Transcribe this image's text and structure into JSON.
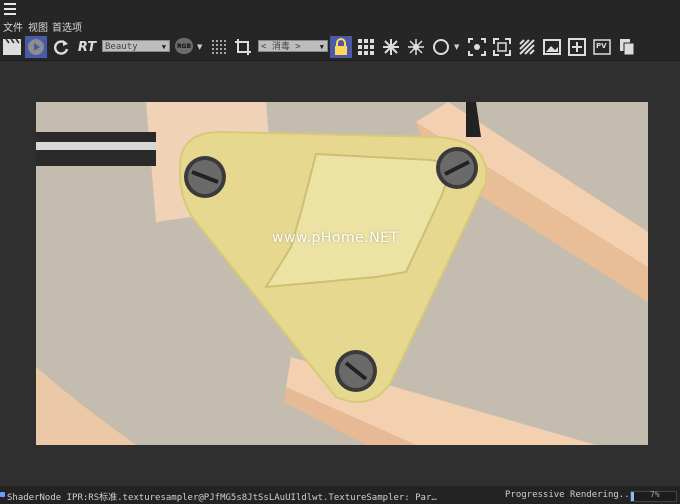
{
  "menu": {
    "items": [
      "文件",
      "视图",
      "首选项"
    ]
  },
  "toolbar": {
    "pass_dropdown": "Beauty",
    "rgb_badge": "RGB",
    "region_dropdown": "< 消毒 >",
    "icons": [
      "clapperboard-icon",
      "play-icon",
      "refresh-icon",
      "rt-icon",
      "grid-dots-icon",
      "crop-icon",
      "lock-icon",
      "grid-icon",
      "snowflake-icon",
      "snowflake-alt-icon",
      "circle-icon",
      "focus-icon",
      "expand-icon",
      "texture-icon",
      "image-icon",
      "add-image-icon",
      "pv-icon",
      "copy-icon"
    ],
    "rt_label": "RT",
    "pv_label": "PV"
  },
  "viewport": {
    "watermark": "www.pHome.NET"
  },
  "status": {
    "message": "ShaderNode IPR:RS标准.texturesampler@PJfMG5s8JtSsLAuUIldlwt.TextureSampler: Par…",
    "progress_label": "Progressive Rendering...",
    "progress_value": 0.07,
    "progress_pct": "7%"
  },
  "colors": {
    "active_button": "#4b5aa8",
    "background_render": "#c4bcae",
    "bracket_yellow": "#e6d98f"
  }
}
